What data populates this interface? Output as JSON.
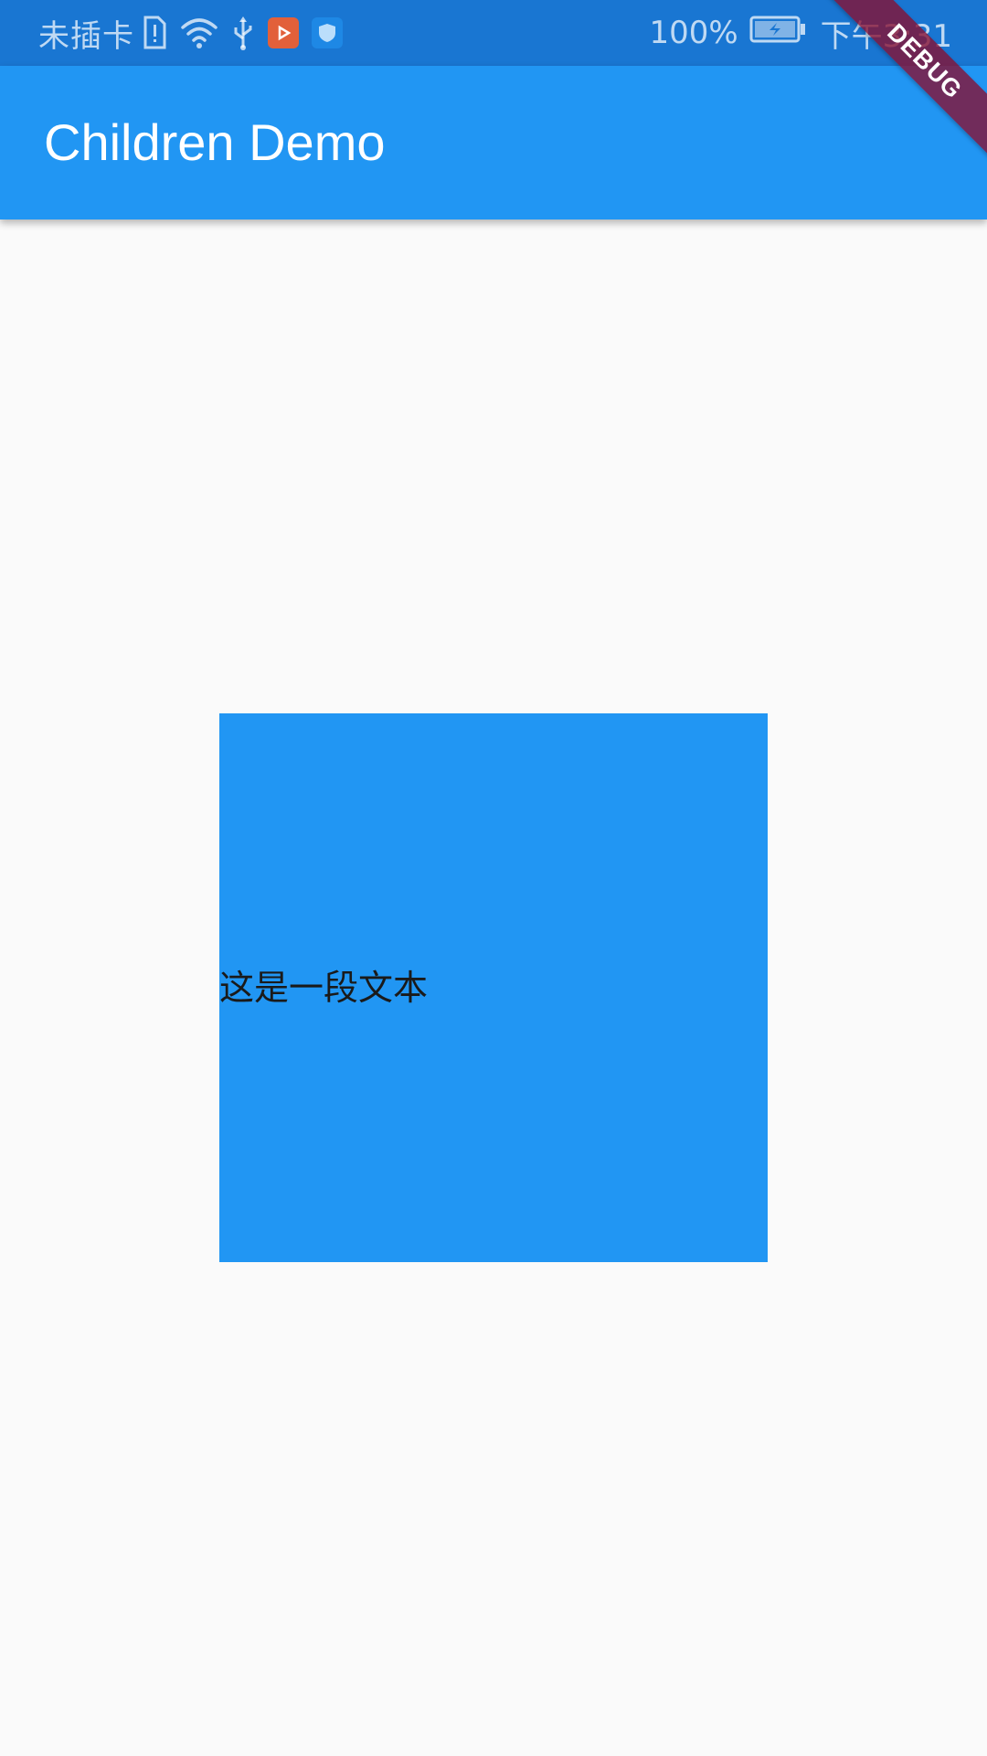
{
  "status_bar": {
    "carrier": "未插卡",
    "battery_percent": "100%",
    "time": "下午3:31",
    "icons": [
      "sim-alert-icon",
      "wifi-icon",
      "usb-icon",
      "video-app-icon",
      "shield-app-icon",
      "battery-charging-icon"
    ],
    "colors": {
      "background": "#1976d2",
      "video_app": "#e2603a",
      "shield_app": "#1e88e5"
    }
  },
  "app_bar": {
    "title": "Children Demo",
    "color": "#2196f3"
  },
  "debug_banner": {
    "label": "DEBUG",
    "color": "#880e30"
  },
  "content": {
    "box_color": "#2196f3",
    "text": "这是一段文本"
  }
}
